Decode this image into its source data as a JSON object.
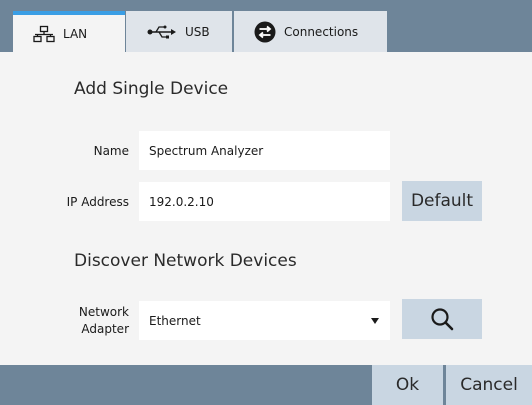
{
  "tabs": {
    "lan": {
      "label": "LAN",
      "icon": "network-icon"
    },
    "usb": {
      "label": "USB",
      "icon": "usb-icon"
    },
    "connections": {
      "label": "Connections",
      "icon": "swap-arrows-icon"
    }
  },
  "add_single": {
    "title": "Add Single Device",
    "name_label": "Name",
    "name_value": "Spectrum Analyzer",
    "ip_label": "IP Address",
    "ip_value": "192.0.2.10",
    "default_label": "Default"
  },
  "discover": {
    "title": "Discover Network Devices",
    "adapter_label_line1": "Network",
    "adapter_label_line2": "Adapter",
    "adapter_value": "Ethernet",
    "search_icon": "search-icon"
  },
  "footer": {
    "ok_label": "Ok",
    "cancel_label": "Cancel"
  },
  "colors": {
    "frame": "#6e8599",
    "panel": "#f4f4f4",
    "tab_inactive": "#dfe4ea",
    "tab_active_accent": "#3a9ee5",
    "button": "#c9d6e2"
  }
}
